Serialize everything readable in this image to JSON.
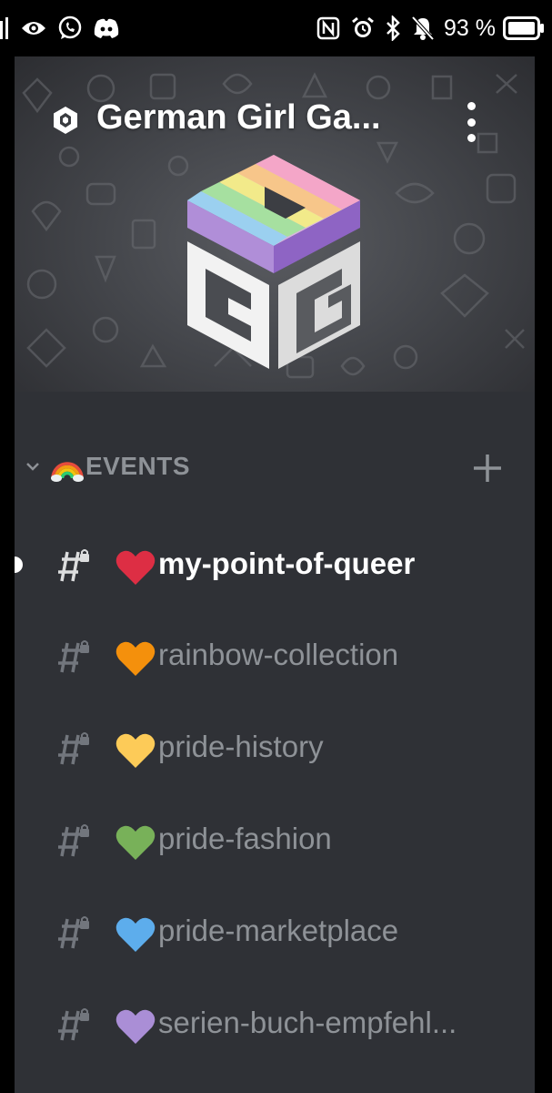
{
  "statusbar": {
    "battery_text": "93 %",
    "left_icons": [
      "signal-icon",
      "eye-icon",
      "whatsapp-icon",
      "discord-icon"
    ],
    "right_icons": [
      "nfc-icon",
      "alarm-icon",
      "bluetooth-icon",
      "mute-icon",
      "battery-icon"
    ]
  },
  "server": {
    "name": "German Girl Ga...",
    "badge_icon": "server-boost-badge-icon",
    "menu_icon": "kebab-menu-icon",
    "logo_letters": "GG"
  },
  "category": {
    "label": "EVENTS",
    "emoji": "rainbow",
    "collapse_icon": "chevron-down-icon",
    "add_icon": "plus-icon"
  },
  "channels": [
    {
      "name": "my-point-of-queer",
      "heart_color": "#dd2e44",
      "active": true,
      "unread": true
    },
    {
      "name": "rainbow-collection",
      "heart_color": "#f4900c",
      "active": false,
      "unread": false
    },
    {
      "name": "pride-history",
      "heart_color": "#fdcb58",
      "active": false,
      "unread": false
    },
    {
      "name": "pride-fashion",
      "heart_color": "#78b159",
      "active": false,
      "unread": false
    },
    {
      "name": "pride-marketplace",
      "heart_color": "#5dadec",
      "active": false,
      "unread": false
    },
    {
      "name": "serien-buch-empfehl...",
      "heart_color": "#aa8ed6",
      "active": false,
      "unread": false
    }
  ],
  "colors": {
    "panel_bg": "#2f3136",
    "muted_text": "#8e9297",
    "active_text": "#ffffff",
    "category_text": "#8e9297"
  }
}
